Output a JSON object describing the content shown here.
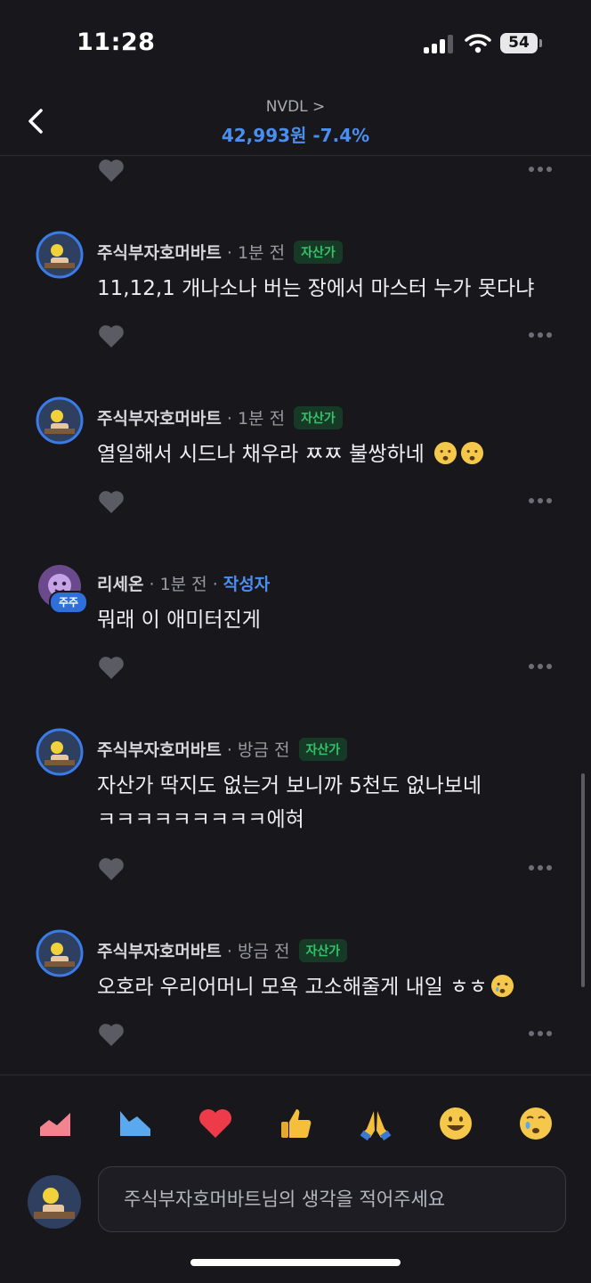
{
  "status": {
    "time": "11:28",
    "battery": "54"
  },
  "header": {
    "ticker": "NVDL >",
    "price": "42,993원 -7.4%"
  },
  "comments": [
    {
      "name": "주식부자호머바트",
      "time": "· 1분 전",
      "badge": "자산가",
      "text": "11,12,1 개나소나 버는 장에서 마스터 누가 못다냐"
    },
    {
      "name": "주식부자호머바트",
      "time": "· 1분 전",
      "badge": "자산가",
      "text": "열일해서 시드나 채우라 ㅉㅉ 불쌍하네"
    },
    {
      "name": "리세온",
      "time": "· 1분 전 ·",
      "author": "작성자",
      "avatar_tag": "주주",
      "text": "뭐래 이 애미터진게"
    },
    {
      "name": "주식부자호머바트",
      "time": "· 방금 전",
      "badge": "자산가",
      "text_line1": "자산가 딱지도 없는거 보니까 5천도 없나보네",
      "text_line2": "ㅋㅋㅋㅋㅋㅋㅋㅋㅋ에혀"
    },
    {
      "name": "주식부자호머바트",
      "time": "· 방금 전",
      "badge": "자산가",
      "text": "오호라 우리어머니 모욕 고소해줄게 내일 ㅎㅎ"
    }
  ],
  "reactions": [
    "chart-up-icon",
    "chart-down-icon",
    "heart-icon",
    "thumbs-up-icon",
    "pray-icon",
    "smile-icon",
    "cry-icon"
  ],
  "composer": {
    "placeholder": "주식부자호머바트님의 생각을 적어주세요"
  },
  "colors": {
    "accent": "#4a8ff0",
    "badge_text": "#35c26a",
    "badge_bg": "#163a25",
    "background": "#17171c"
  }
}
